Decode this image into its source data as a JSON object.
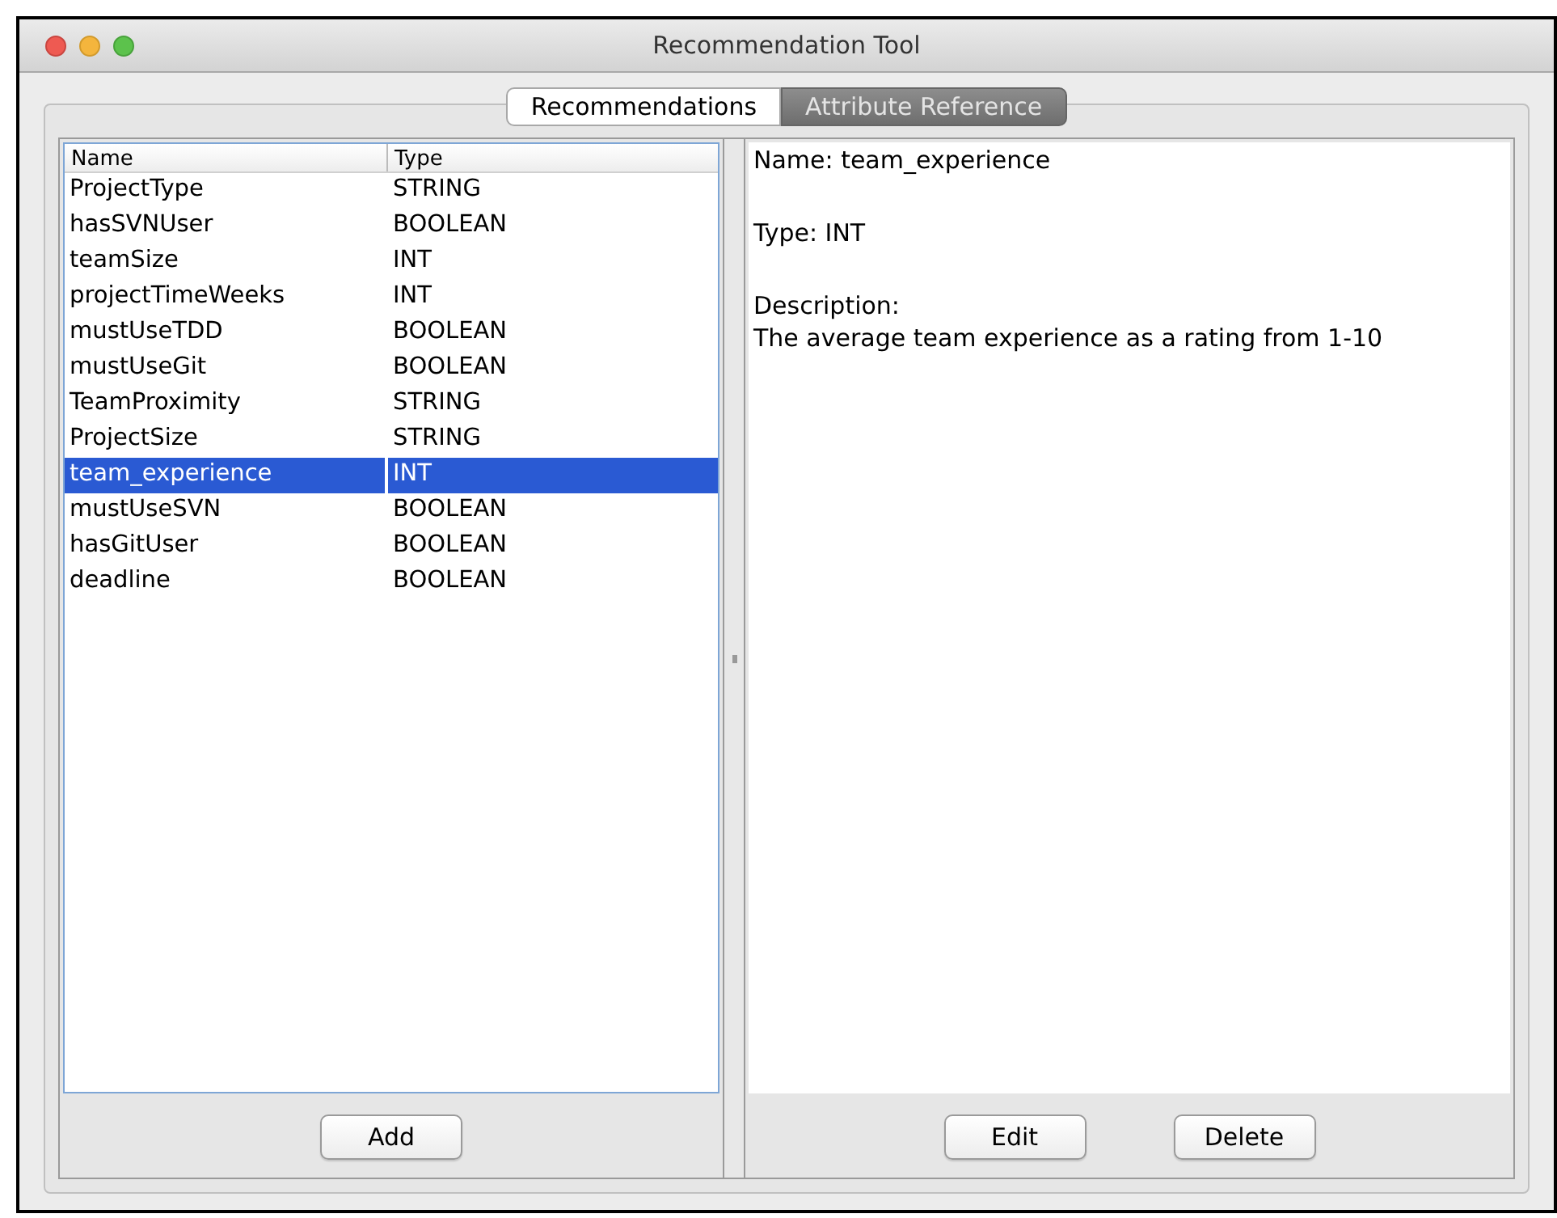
{
  "window": {
    "title": "Recommendation Tool"
  },
  "tabs": [
    {
      "label": "Recommendations",
      "selected": false
    },
    {
      "label": "Attribute Reference",
      "selected": true
    }
  ],
  "table": {
    "columns": [
      "Name",
      "Type"
    ],
    "rows": [
      {
        "name": "ProjectType",
        "type": "STRING",
        "selected": false
      },
      {
        "name": "hasSVNUser",
        "type": "BOOLEAN",
        "selected": false
      },
      {
        "name": "teamSize",
        "type": "INT",
        "selected": false
      },
      {
        "name": "projectTimeWeeks",
        "type": "INT",
        "selected": false
      },
      {
        "name": "mustUseTDD",
        "type": "BOOLEAN",
        "selected": false
      },
      {
        "name": "mustUseGit",
        "type": "BOOLEAN",
        "selected": false
      },
      {
        "name": "TeamProximity",
        "type": "STRING",
        "selected": false
      },
      {
        "name": "ProjectSize",
        "type": "STRING",
        "selected": false
      },
      {
        "name": "team_experience",
        "type": "INT",
        "selected": true
      },
      {
        "name": "mustUseSVN",
        "type": "BOOLEAN",
        "selected": false
      },
      {
        "name": "hasGitUser",
        "type": "BOOLEAN",
        "selected": false
      },
      {
        "name": "deadline",
        "type": "BOOLEAN",
        "selected": false
      }
    ]
  },
  "left_buttons": [
    "Add"
  ],
  "detail": {
    "name_line": "Name: team_experience",
    "type_line": "Type: INT",
    "description_label": "Description:",
    "description": "The average team experience as a rating from 1-10"
  },
  "right_buttons": [
    "Edit",
    "Delete"
  ]
}
